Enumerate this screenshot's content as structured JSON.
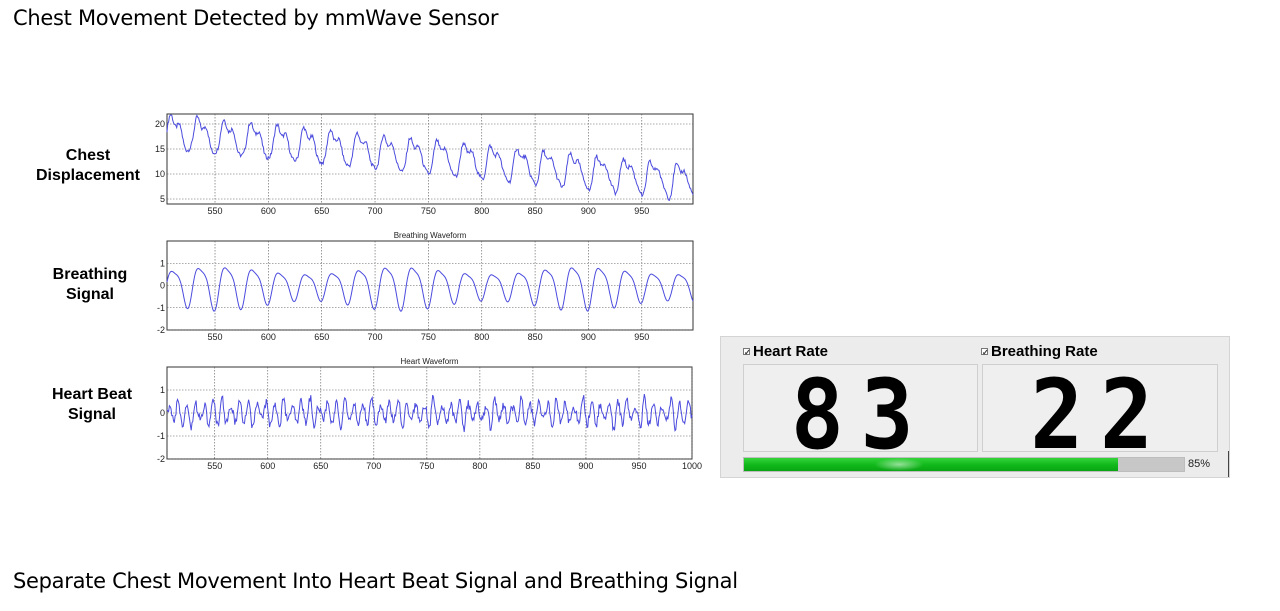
{
  "page": {
    "title": "Chest Movement Detected by mmWave Sensor",
    "caption": "Separate Chest Movement Into Heart Beat Signal and Breathing Signal"
  },
  "row_labels": {
    "chest": [
      "Chest",
      "Displacement"
    ],
    "breathing": [
      "Breathing",
      "Signal"
    ],
    "heart": [
      "Heart Beat",
      "Signal"
    ]
  },
  "chart_data": [
    {
      "type": "line",
      "title": "",
      "xlabel": "",
      "ylabel": "",
      "xlim": [
        505,
        998
      ],
      "ylim": [
        4,
        22
      ],
      "x_ticks": [
        550,
        600,
        650,
        700,
        750,
        800,
        850,
        900,
        950
      ],
      "y_ticks": [
        5,
        10,
        15,
        20
      ],
      "grid": true,
      "line_color": "#4b4bde",
      "signal": {
        "x_start": 505,
        "x_end": 998,
        "trend_start": 18.5,
        "trend_end": 8.5,
        "breath_period": 25,
        "breath_amplitude": 3.0,
        "heart_period": 8.3,
        "heart_amplitude": 0.6
      }
    },
    {
      "type": "line",
      "title": "Breathing Waveform",
      "xlabel": "",
      "ylabel": "",
      "xlim": [
        505,
        998
      ],
      "ylim": [
        -2,
        2
      ],
      "x_ticks": [
        550,
        600,
        650,
        700,
        750,
        800,
        850,
        900,
        950
      ],
      "y_ticks": [
        -2,
        -1,
        0,
        1
      ],
      "grid": true,
      "line_color": "#4b4bde",
      "signal": {
        "x_start": 505,
        "x_end": 998,
        "period": 25,
        "amplitude": 0.75,
        "offset": 0.0
      }
    },
    {
      "type": "line",
      "title": "Heart Waveform",
      "xlabel": "",
      "ylabel": "",
      "xlim": [
        505,
        1000
      ],
      "ylim": [
        -2,
        2
      ],
      "x_ticks": [
        550,
        600,
        650,
        700,
        750,
        800,
        850,
        900,
        950,
        1000
      ],
      "y_ticks": [
        -2,
        -1,
        0,
        1
      ],
      "grid": true,
      "line_color": "#4b4bde",
      "signal": {
        "x_start": 505,
        "x_end": 1000,
        "period": 8.3,
        "amplitude": 0.45,
        "offset": 0.0
      }
    }
  ],
  "rates": {
    "heart": {
      "label": "Heart Rate",
      "value": "83",
      "checked": true
    },
    "breathing": {
      "label": "Breathing Rate",
      "value": "22",
      "checked": true
    }
  },
  "progress": {
    "value": 0.85,
    "text": "85%"
  },
  "colors": {
    "line": "#4b4bde",
    "progress_green": "#10b81a",
    "track": "#c7c7c7"
  }
}
